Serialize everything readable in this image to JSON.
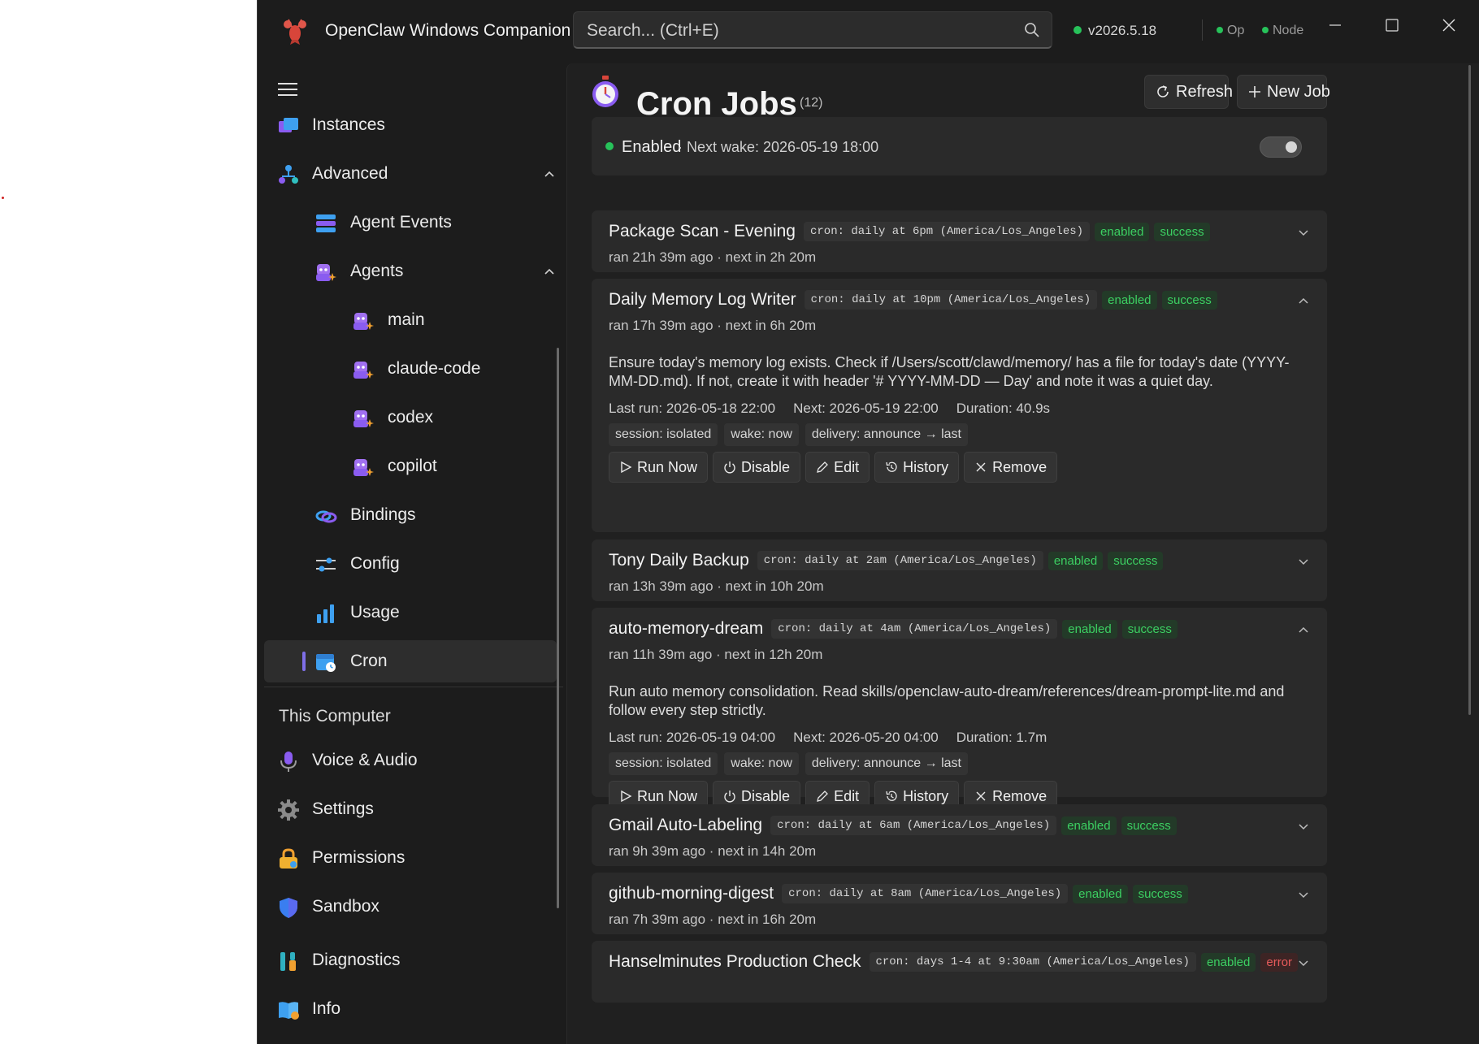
{
  "app": {
    "title": "OpenClaw Windows Companion",
    "version": "v2026.5.18",
    "status_op": "Op",
    "status_node": "Node"
  },
  "search": {
    "placeholder": "Search... (Ctrl+E)"
  },
  "sidebar": {
    "items": [
      {
        "label": "Instances",
        "icon": "instances-icon"
      },
      {
        "label": "Advanced",
        "icon": "advanced-icon",
        "expanded": true
      },
      {
        "label": "Agent Events",
        "icon": "agent-events-icon"
      },
      {
        "label": "Agents",
        "icon": "agents-icon",
        "expanded": true
      },
      {
        "label": "main",
        "icon": "agent-icon"
      },
      {
        "label": "claude-code",
        "icon": "agent-icon"
      },
      {
        "label": "codex",
        "icon": "agent-icon"
      },
      {
        "label": "copilot",
        "icon": "agent-icon"
      },
      {
        "label": "Bindings",
        "icon": "bindings-icon"
      },
      {
        "label": "Config",
        "icon": "config-icon"
      },
      {
        "label": "Usage",
        "icon": "usage-icon"
      },
      {
        "label": "Cron",
        "icon": "cron-icon",
        "selected": true
      }
    ],
    "section_this_computer": "This Computer",
    "computer_items": [
      {
        "label": "Voice & Audio",
        "icon": "microphone-icon"
      },
      {
        "label": "Settings",
        "icon": "gear-icon"
      },
      {
        "label": "Permissions",
        "icon": "lock-icon"
      },
      {
        "label": "Sandbox",
        "icon": "shield-icon"
      },
      {
        "label": "Diagnostics",
        "icon": "tools-icon"
      },
      {
        "label": "Info",
        "icon": "book-icon"
      }
    ]
  },
  "page": {
    "title": "Cron Jobs",
    "count": "(12)",
    "refresh_label": "Refresh",
    "new_job_label": "New Job",
    "enabled_label": "Enabled",
    "next_wake": "· Next wake: 2026-05-19 18:00",
    "scheduler_enabled": true
  },
  "jobs": [
    {
      "name": "Package Scan - Evening",
      "cron": "cron: daily at 6pm (America/Los_Angeles)",
      "state": "enabled",
      "result": "success",
      "sub": "ran 21h 39m ago · next in 2h 20m",
      "expanded": false
    },
    {
      "name": "Daily Memory Log Writer",
      "cron": "cron: daily at 10pm (America/Los_Angeles)",
      "state": "enabled",
      "result": "success",
      "sub": "ran 17h 39m ago · next in 6h 20m",
      "expanded": true,
      "description": "Ensure today's memory log exists. Check if /Users/scott/clawd/memory/ has a file for today's date (YYYY-MM-DD.md). If not, create it with header '# YYYY-MM-DD — Day' and note it was a quiet day.",
      "last_run": "Last run: 2026-05-18 22:00",
      "next": "Next: 2026-05-19 22:00",
      "duration": "Duration: 40.9s",
      "chips": [
        "session: isolated",
        "wake: now",
        "delivery: announce → last"
      ]
    },
    {
      "name": "Tony Daily Backup",
      "cron": "cron: daily at 2am (America/Los_Angeles)",
      "state": "enabled",
      "result": "success",
      "sub": "ran 13h 39m ago · next in 10h 20m",
      "expanded": false
    },
    {
      "name": "auto-memory-dream",
      "cron": "cron: daily at 4am (America/Los_Angeles)",
      "state": "enabled",
      "result": "success",
      "sub": "ran 11h 39m ago · next in 12h 20m",
      "expanded": true,
      "description": "Run auto memory consolidation. Read skills/openclaw-auto-dream/references/dream-prompt-lite.md and follow every step strictly.",
      "last_run": "Last run: 2026-05-19 04:00",
      "next": "Next: 2026-05-20 04:00",
      "duration": "Duration: 1.7m",
      "chips": [
        "session: isolated",
        "wake: now",
        "delivery: announce → last"
      ]
    },
    {
      "name": "Gmail Auto-Labeling",
      "cron": "cron: daily at 6am (America/Los_Angeles)",
      "state": "enabled",
      "result": "success",
      "sub": "ran 9h 39m ago · next in 14h 20m",
      "expanded": false
    },
    {
      "name": "github-morning-digest",
      "cron": "cron: daily at 8am (America/Los_Angeles)",
      "state": "enabled",
      "result": "success",
      "sub": "ran 7h 39m ago · next in 16h 20m",
      "expanded": false
    },
    {
      "name": "Hanselminutes Production Check",
      "cron": "cron: days 1-4 at 9:30am (America/Los_Angeles)",
      "state": "enabled",
      "result": "error",
      "sub": "",
      "expanded": false
    }
  ],
  "actions": {
    "run_now": "Run Now",
    "disable": "Disable",
    "edit": "Edit",
    "history": "History",
    "remove": "Remove"
  },
  "colors": {
    "accent": "#7f6fe8",
    "success": "#3ccf62",
    "error": "#e55a5a",
    "background": "#1c1c1c"
  }
}
